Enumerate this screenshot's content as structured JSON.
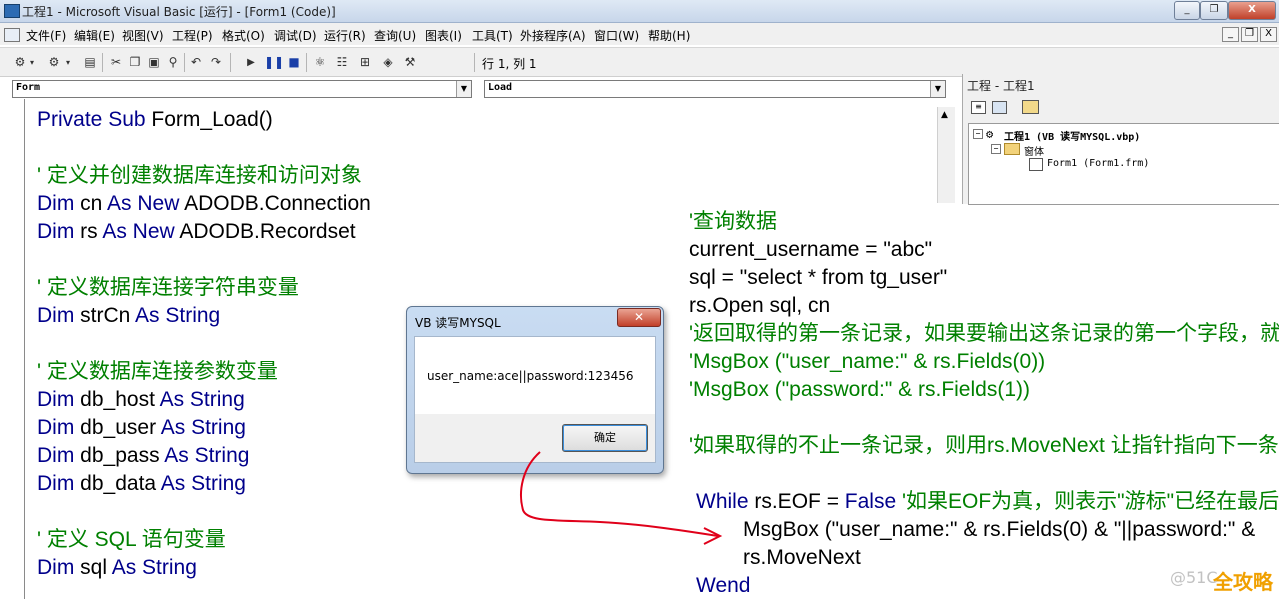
{
  "window": {
    "title": "工程1 - Microsoft Visual Basic [运行] - [Form1 (Code)]",
    "controls": [
      "_",
      "❐",
      "X"
    ]
  },
  "menubar": {
    "items": [
      "文件(F)",
      "编辑(E)",
      "视图(V)",
      "工程(P)",
      "格式(O)",
      "调试(D)",
      "运行(R)",
      "查询(U)",
      "图表(I)",
      "工具(T)",
      "外接程序(A)",
      "窗口(W)",
      "帮助(H)"
    ],
    "mdi_controls": [
      "_",
      "❐",
      "X"
    ]
  },
  "toolbar": {
    "position_text": "行 1, 列 1"
  },
  "editor": {
    "object_combo": "Form",
    "procedure_combo": "Load",
    "left_code": [
      [
        {
          "t": "Private Sub ",
          "c": "kw"
        },
        {
          "t": "Form_Load()",
          "c": "tx"
        }
      ],
      [],
      [
        {
          "t": "' 定义并创建数据库连接和访问对象",
          "c": "cm"
        }
      ],
      [
        {
          "t": "Dim ",
          "c": "kw"
        },
        {
          "t": "cn ",
          "c": "tx"
        },
        {
          "t": "As New ",
          "c": "kw"
        },
        {
          "t": "ADODB.Connection",
          "c": "tx"
        }
      ],
      [
        {
          "t": "Dim ",
          "c": "kw"
        },
        {
          "t": "rs ",
          "c": "tx"
        },
        {
          "t": "As New ",
          "c": "kw"
        },
        {
          "t": "ADODB.Recordset",
          "c": "tx"
        }
      ],
      [],
      [
        {
          "t": "' 定义数据库连接字符串变量",
          "c": "cm"
        }
      ],
      [
        {
          "t": "Dim ",
          "c": "kw"
        },
        {
          "t": "strCn ",
          "c": "tx"
        },
        {
          "t": "As String",
          "c": "kw"
        }
      ],
      [],
      [
        {
          "t": "' 定义数据库连接参数变量",
          "c": "cm"
        }
      ],
      [
        {
          "t": "Dim ",
          "c": "kw"
        },
        {
          "t": "db_host ",
          "c": "tx"
        },
        {
          "t": "As String",
          "c": "kw"
        }
      ],
      [
        {
          "t": "Dim ",
          "c": "kw"
        },
        {
          "t": "db_user ",
          "c": "tx"
        },
        {
          "t": "As String",
          "c": "kw"
        }
      ],
      [
        {
          "t": "Dim ",
          "c": "kw"
        },
        {
          "t": "db_pass ",
          "c": "tx"
        },
        {
          "t": "As String",
          "c": "kw"
        }
      ],
      [
        {
          "t": "Dim ",
          "c": "kw"
        },
        {
          "t": "db_data ",
          "c": "tx"
        },
        {
          "t": "As String",
          "c": "kw"
        }
      ],
      [],
      [
        {
          "t": "' 定义 SQL 语句变量",
          "c": "cm"
        }
      ],
      [
        {
          "t": "Dim ",
          "c": "kw"
        },
        {
          "t": "sql ",
          "c": "tx"
        },
        {
          "t": "As String",
          "c": "kw"
        }
      ]
    ],
    "right_code": [
      {
        "indent": 0,
        "parts": [
          {
            "t": "'查询数据",
            "c": "cm"
          }
        ]
      },
      {
        "indent": 0,
        "parts": [
          {
            "t": "current_username = \"abc\"",
            "c": "tx"
          }
        ]
      },
      {
        "indent": 0,
        "parts": [
          {
            "t": "sql = \"select * from tg_user\"",
            "c": "tx"
          }
        ]
      },
      {
        "indent": 0,
        "parts": [
          {
            "t": "rs.Open sql, cn",
            "c": "tx"
          }
        ]
      },
      {
        "indent": 0,
        "parts": [
          {
            "t": "'返回取得的第一条记录，如果要输出这条记录的第一个字段，就",
            "c": "cm"
          }
        ]
      },
      {
        "indent": 0,
        "parts": [
          {
            "t": "'MsgBox (\"user_name:\" & rs.Fields(0))",
            "c": "cm"
          }
        ]
      },
      {
        "indent": 0,
        "parts": [
          {
            "t": "'MsgBox (\"password:\" & rs.Fields(1))",
            "c": "cm"
          }
        ]
      },
      {
        "indent": 0,
        "parts": []
      },
      {
        "indent": 0,
        "parts": [
          {
            "t": "'如果取得的不止一条记录，则用rs.MoveNext 让指针指向下一条",
            "c": "cm"
          }
        ]
      },
      {
        "indent": 0,
        "parts": []
      },
      {
        "indent": 1,
        "parts": [
          {
            "t": "While ",
            "c": "kw"
          },
          {
            "t": "rs.EOF = ",
            "c": "tx"
          },
          {
            "t": "False ",
            "c": "kw"
          },
          {
            "t": "'如果EOF为真，则表示\"游标\"已经在最后",
            "c": "cm"
          }
        ]
      },
      {
        "indent": 2,
        "parts": [
          {
            "t": "MsgBox (\"user_name:\" & rs.Fields(0) & \"||password:\" &",
            "c": "tx"
          }
        ]
      },
      {
        "indent": 2,
        "parts": [
          {
            "t": "rs.MoveNext",
            "c": "tx"
          }
        ]
      },
      {
        "indent": 1,
        "parts": [
          {
            "t": "Wend",
            "c": "kw"
          }
        ]
      }
    ]
  },
  "project_panel": {
    "title": "工程 - 工程1",
    "tree": [
      "工程1 (VB 读写MYSQL.vbp)",
      "窗体",
      "Form1 (Form1.frm)"
    ]
  },
  "dialog": {
    "title": "VB 读写MYSQL",
    "message": "user_name:ace||password:123456",
    "ok_label": "确定"
  },
  "watermark": {
    "text": "@51C",
    "logo": "全攻略"
  },
  "colors": {
    "keyword": "#00008b",
    "comment": "#008000",
    "arrow": "#e0001a"
  }
}
